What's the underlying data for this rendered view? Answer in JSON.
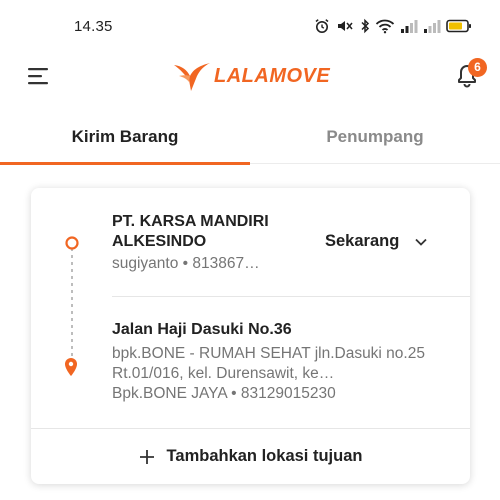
{
  "status_bar": {
    "time": "14.35",
    "icons": [
      "alarm-icon",
      "mute-icon",
      "bluetooth-icon",
      "wifi-icon",
      "signal-icon",
      "signal-icon",
      "battery-icon"
    ]
  },
  "header": {
    "menu_icon": "hamburger-menu-icon",
    "logo_text": "LALAMOVE",
    "notification_count": "6"
  },
  "tabs": [
    {
      "label": "Kirim Barang",
      "active": true
    },
    {
      "label": "Penumpang",
      "active": false
    }
  ],
  "pickup": {
    "title": "PT. KARSA MANDIRI ALKESINDO",
    "subtitle": "sugiyanto • 813867…",
    "time_label": "Sekarang"
  },
  "dropoff": {
    "title": "Jalan Haji Dasuki No.36",
    "address": "bpk.BONE - RUMAH SEHAT  jln.Dasuki no.25 Rt.01/016, kel. Durensawit, ke…",
    "contact": "Bpk.BONE JAYA • 83129015230"
  },
  "add_destination_label": "Tambahkan lokasi tujuan",
  "colors": {
    "accent": "#f16622",
    "text": "#222222",
    "muted": "#757575"
  }
}
